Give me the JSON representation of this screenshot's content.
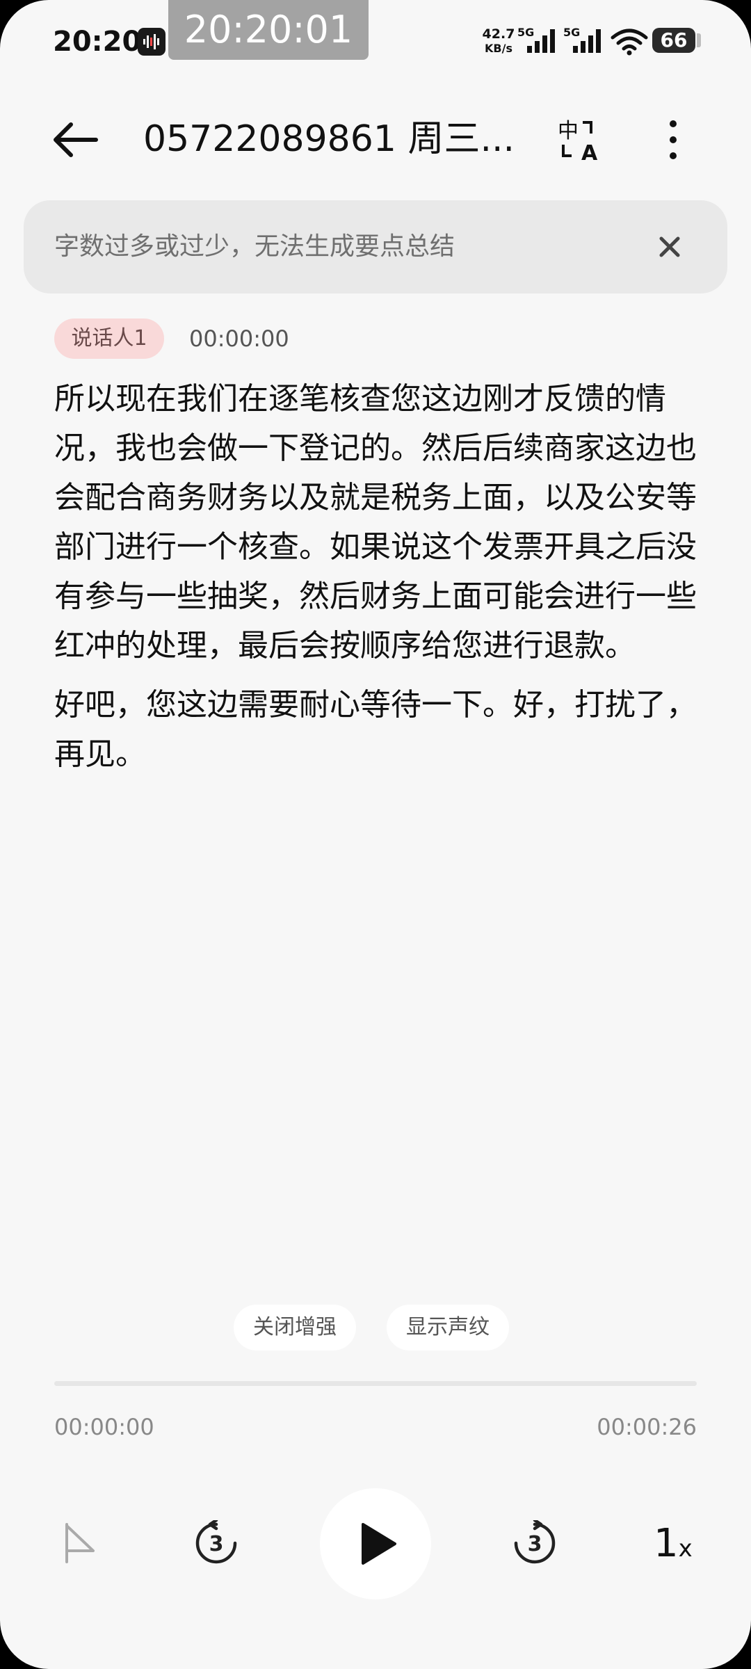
{
  "status_bar": {
    "time": "20:20",
    "clock_overlay": "20:20:01",
    "net_speed_value": "42.7",
    "net_speed_unit": "KB/s",
    "network_1": "5G",
    "network_2": "5G",
    "battery": "66",
    "icons": [
      "voice-recorder-icon",
      "signal-icon",
      "signal-icon",
      "wifi-icon",
      "battery-icon"
    ]
  },
  "header": {
    "title": "05722089861 周三...",
    "icons": [
      "back-arrow-icon",
      "translate-icon",
      "more-vertical-icon"
    ]
  },
  "notice": {
    "text": "字数过多或过少，无法生成要点总结",
    "icon": "close-icon"
  },
  "transcript": {
    "speaker": "说话人1",
    "timestamp": "00:00:00",
    "paragraphs": [
      "所以现在我们在逐笔核查您这边刚才反馈的情况，我也会做一下登记的。然后后续商家这边也会配合商务财务以及就是税务上面，以及公安等部门进行一个核查。如果说这个发票开具之后没有参与一些抽奖，然后财务上面可能会进行一些红冲的处理，最后会按顺序给您进行退款。",
      "好吧，您这边需要耐心等待一下。好，打扰了，再见。"
    ]
  },
  "actions": {
    "enhance_label": "关闭增强",
    "voiceprint_label": "显示声纹"
  },
  "player": {
    "current_time": "00:00:00",
    "total_time": "00:00:26",
    "progress": 0,
    "speed_value": "1",
    "speed_suffix": "x",
    "icons": [
      "flag-icon",
      "rewind-3-icon",
      "play-icon",
      "forward-3-icon"
    ],
    "rewind_seconds": "3",
    "forward_seconds": "3"
  },
  "colors": {
    "background": "#f7f7f7",
    "notice_bg": "#e9e9e9",
    "speaker_chip_bg": "#f9d9d9",
    "text_primary": "#111111",
    "text_secondary": "#888888"
  }
}
